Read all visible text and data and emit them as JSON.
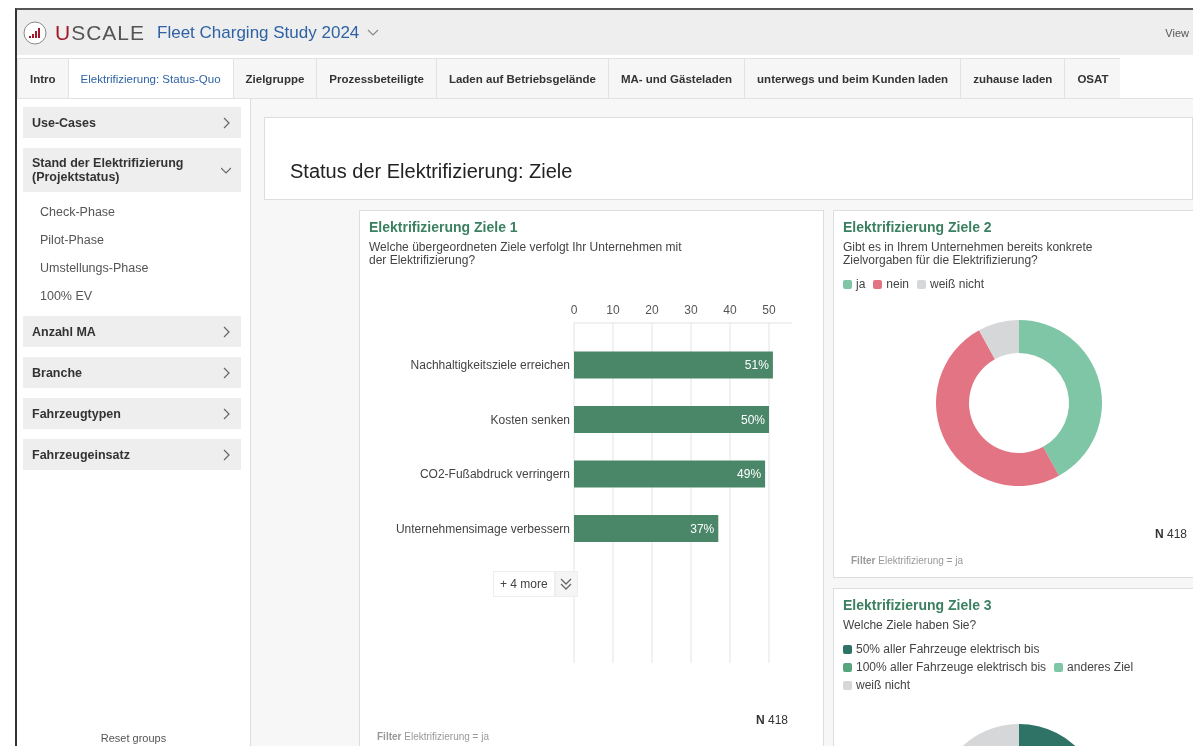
{
  "header": {
    "logo": "USCALE",
    "title": "Fleet Charging Study 2024",
    "view_link": "View"
  },
  "tabs": [
    {
      "label": "Intro",
      "selected": false
    },
    {
      "label": "Elektrifizierung: Status-Quo",
      "selected": true
    },
    {
      "label": "Zielgruppe",
      "selected": false
    },
    {
      "label": "Prozessbeteiligte",
      "selected": false
    },
    {
      "label": "Laden auf Betriebsgelände",
      "selected": false
    },
    {
      "label": "MA- und Gästeladen",
      "selected": false
    },
    {
      "label": "unterwegs und beim Kunden laden",
      "selected": false
    },
    {
      "label": "zuhause laden",
      "selected": false
    },
    {
      "label": "OSAT",
      "selected": false
    }
  ],
  "sidebar": {
    "groups": [
      {
        "label": "Use-Cases",
        "expanded": false
      },
      {
        "label": "Stand der Elektrifizierung (Projektstatus)",
        "expanded": true,
        "children": [
          {
            "label": "Check-Phase"
          },
          {
            "label": "Pilot-Phase"
          },
          {
            "label": "Umstellungs-Phase"
          },
          {
            "label": "100% EV"
          }
        ]
      },
      {
        "label": "Anzahl MA",
        "expanded": false
      },
      {
        "label": "Branche",
        "expanded": false
      },
      {
        "label": "Fahrzeugtypen",
        "expanded": false
      },
      {
        "label": "Fahrzeugeinsatz",
        "expanded": false
      }
    ],
    "reset": "Reset groups"
  },
  "page_title": "Status der Elektrifizierung: Ziele",
  "cards": [
    {
      "kind": "bar",
      "title": "Elektrifizierung Ziele 1",
      "question": "Welche übergeordneten Ziele verfolgt Ihr Unternehmen mit der Elektrifizierung?",
      "more_button": "+ 4 more",
      "n_label": "N",
      "n_value": "418",
      "filter_label": "Filter",
      "filter_text": "Elektrifizierung = ja",
      "chart_data": {
        "type": "bar",
        "orientation": "horizontal",
        "categories": [
          "Nachhaltigkeitsziele erreichen",
          "Kosten senken",
          "CO2-Fußabdruck verringern",
          "Unternehmensimage verbessern"
        ],
        "values": [
          51,
          50,
          49,
          37
        ],
        "grid": true,
        "xlim": [
          0,
          56
        ],
        "xticks": [
          0,
          10,
          20,
          30,
          40,
          50
        ],
        "value_labels": [
          "51%",
          "50%",
          "49%",
          "37%"
        ]
      }
    },
    {
      "kind": "donut",
      "title": "Elektrifizierung Ziele 2",
      "question": "Gibt es in Ihrem Unternehmen bereits konkrete Zielvorgaben für die Elektrifizierung?",
      "n_label": "N",
      "n_value": "418",
      "filter_label": "Filter",
      "filter_text": "Elektrifizierung = ja",
      "legend": [
        {
          "color": "#7ec6a5"
        },
        {
          "color": "#e27483"
        },
        {
          "color": "#d6d7d9"
        }
      ],
      "chart_data": {
        "type": "donut",
        "legend": true,
        "categories": [
          "ja",
          "nein",
          "weiß nicht"
        ],
        "values": [
          42,
          50,
          8
        ]
      }
    },
    {
      "kind": "donut",
      "title": "Elektrifizierung Ziele 3",
      "question": "Welche Ziele haben Sie?",
      "legend": [
        {
          "label": "50% aller Fahrzeuge elektrisch bis",
          "color": "#2e7366"
        },
        {
          "label": "100% aller Fahrzeuge elektrisch bis",
          "color": "#56a57d"
        },
        {
          "label": "anderes Ziel",
          "color": "#7ec6a5"
        },
        {
          "label": "weiß nicht",
          "color": "#d6d7d9"
        }
      ]
    }
  ]
}
